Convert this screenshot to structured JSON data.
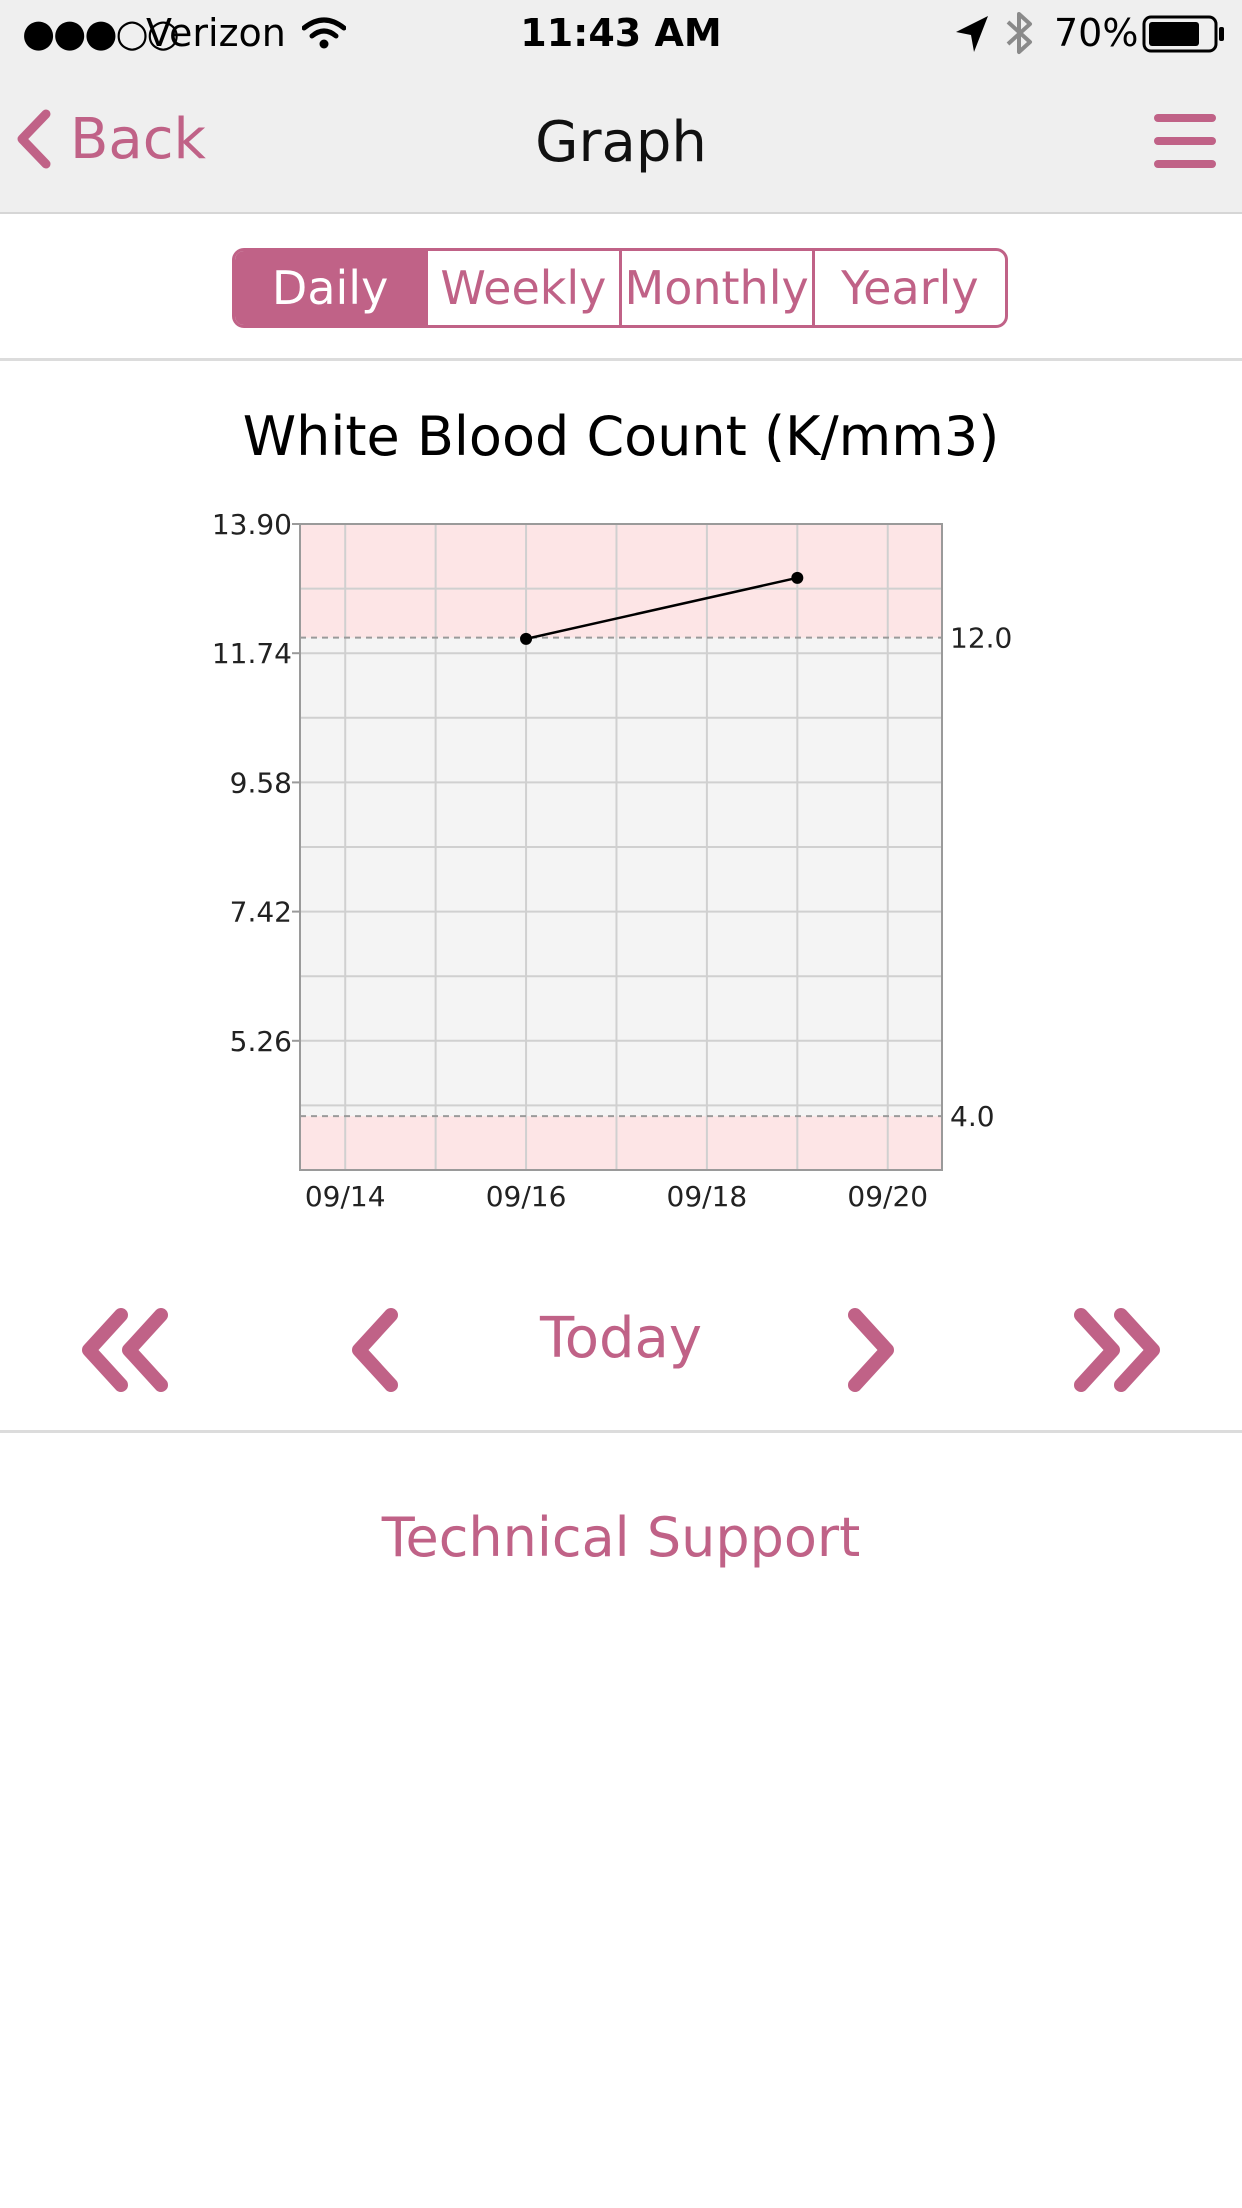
{
  "status_bar": {
    "signal": "●●●○○",
    "carrier": "Verizon",
    "time": "11:43 AM",
    "battery": "70%",
    "icons": [
      "wifi-icon",
      "location-arrow-icon",
      "bluetooth-icon",
      "battery-icon"
    ]
  },
  "nav": {
    "back_label": "Back",
    "title": "Graph",
    "menu_icon": "hamburger-menu-icon"
  },
  "segments": [
    {
      "label": "Daily",
      "active": true
    },
    {
      "label": "Weekly",
      "active": false
    },
    {
      "label": "Monthly",
      "active": false
    },
    {
      "label": "Yearly",
      "active": false
    }
  ],
  "chart_title": "White Blood Count (K/mm3)",
  "chart_data": {
    "type": "line",
    "title": "White Blood Count (K/mm3)",
    "y_ticks": [
      "13.90",
      "11.74",
      "9.58",
      "7.42",
      "5.26"
    ],
    "ylim": [
      3.1,
      13.9
    ],
    "x_ticks": [
      "09/14",
      "09/16",
      "09/18",
      "09/20"
    ],
    "x_dates_range": [
      "09/13.5",
      "09/20.6"
    ],
    "series": [
      {
        "values": [
          {
            "x": "09/16",
            "y": 11.98
          },
          {
            "x": "09/19",
            "y": 13.0
          }
        ]
      }
    ],
    "reference_lines": [
      {
        "value": 12.0,
        "label": "12.0"
      },
      {
        "value": 4.0,
        "label": "4.0"
      }
    ],
    "grid": true,
    "colors": {
      "plot_bg": "#f4f4f4",
      "out_of_range_bg": "#fde5e6",
      "line": "#000000",
      "grid": "#d0d0d0"
    }
  },
  "pager": {
    "first_icon": "double-chevron-left-icon",
    "prev_icon": "chevron-left-icon",
    "today_label": "Today",
    "next_icon": "chevron-right-icon",
    "last_icon": "double-chevron-right-icon"
  },
  "support_label": "Technical Support",
  "colors": {
    "accent": "#c06287"
  }
}
